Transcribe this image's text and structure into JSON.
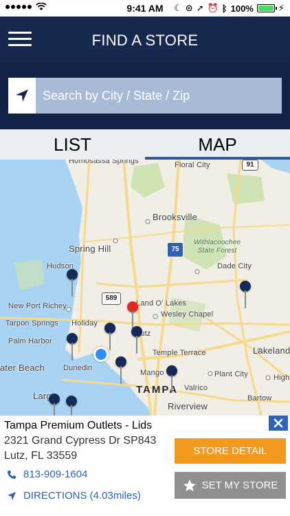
{
  "status_bar": {
    "time": "9:41 AM",
    "battery": "100%",
    "battery_level": 1.0
  },
  "header": {
    "title": "FIND A STORE",
    "menu_icon": "hamburger-menu-icon"
  },
  "search": {
    "placeholder": "Search by City / State / Zip",
    "locate_icon": "location-arrow-icon"
  },
  "tabs": [
    {
      "label": "LIST",
      "active": false
    },
    {
      "label": "MAP",
      "active": true
    }
  ],
  "map": {
    "labels": {
      "homosassa_springs": "Homosassa Springs",
      "floral_city": "Floral City",
      "brooksville": "Brooksville",
      "spring_hill": "Spring Hill",
      "withlacoochee": "Withlacoochee\nState Forest",
      "hudson": "Hudson",
      "dade_city": "Dade City",
      "new_port_richey": "New Port Richey",
      "land_o_lakes": "Land O' Lakes",
      "wesley_chapel": "Wesley Chapel",
      "tarpon_springs": "Tarpon Springs",
      "holiday": "Holiday",
      "palm_harbor": "Palm Harbor",
      "lutz": "Lutz",
      "temple_terrace": "Temple Terrace",
      "lakeland": "Lakeland",
      "clear_beach": "ater Beach",
      "dunedin": "Dunedin",
      "mango": "Mango",
      "plant_city": "Plant City",
      "high": "High",
      "tampa": "TAMPA",
      "valrico": "Valrico",
      "bartow": "Bartow",
      "largo": "Larg",
      "riverview": "Riverview"
    },
    "shields": {
      "i75": "75",
      "r589": "589",
      "r91": "91"
    },
    "colors": {
      "water": "#a9d3f2",
      "land": "#f1eee6",
      "road": "#f6d98a",
      "park": "#cfe3b5",
      "pin": "#162a58",
      "selected_pin": "#e42626",
      "user": "#2f8fff"
    }
  },
  "store": {
    "name": "Tampa Premium Outlets - Lids",
    "address_line1": "2321 Grand Cypress Dr SP843",
    "address_line2": "Lutz, FL 33559",
    "phone": "813-909-1604",
    "directions": "DIRECTIONS (4.03miles)",
    "detail_button": "STORE DETAIL",
    "set_button": "SET MY STORE"
  },
  "colors": {
    "header": "#17284f",
    "search_band": "#132247",
    "search_field": "#a8bad6",
    "tab_bg": "#ebeef3",
    "tab_underline": "#2f5b95",
    "link": "#2d63b8",
    "detail_button": "#f39a1e",
    "set_button": "#8f8f8f"
  }
}
